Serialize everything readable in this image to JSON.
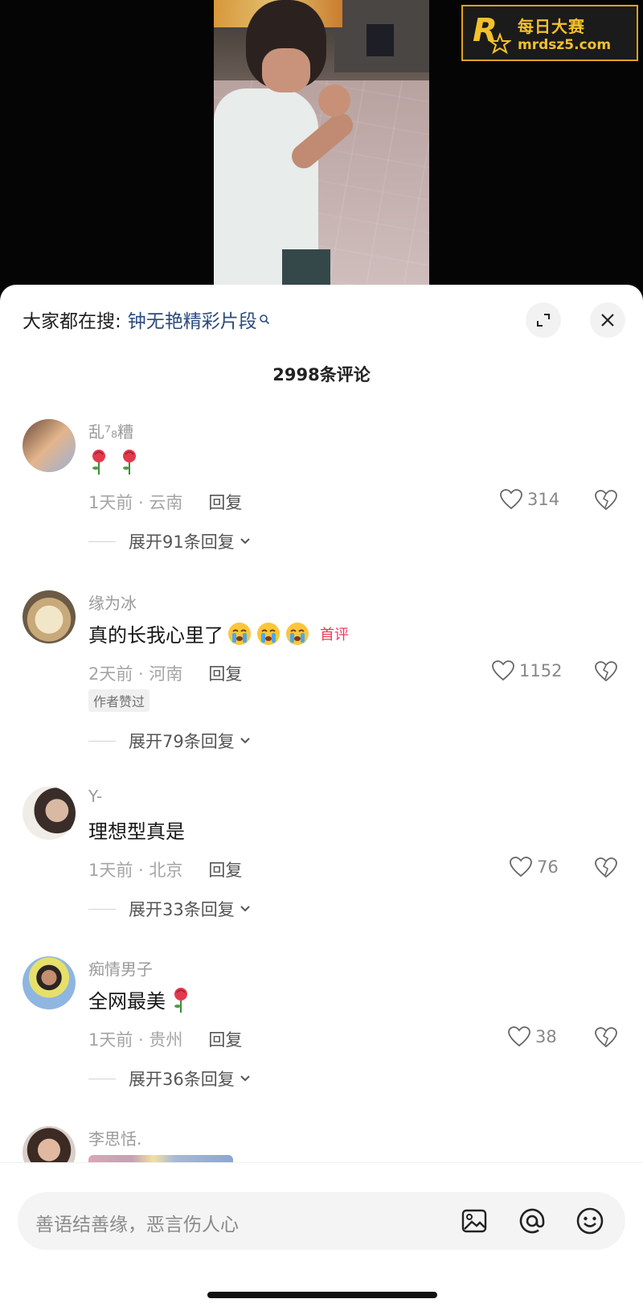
{
  "watermark": {
    "brand_cn": "每日大赛",
    "url": "mrdsz5.com",
    "brand_color": "#f3c12a"
  },
  "panel": {
    "search_prefix": "大家都在搜:",
    "search_term": "钟无艳精彩片段",
    "comment_count": "2998条评论"
  },
  "comments": [
    {
      "username": "乱⁷₈糟",
      "text": "",
      "time_location": "1天前 · 云南",
      "reply_label": "回复",
      "likes": "314",
      "expand_label": "展开91条回复"
    },
    {
      "username": "缘为冰",
      "text": "真的长我心里了",
      "first_tag": "首评",
      "time_location": "2天前 · 河南",
      "reply_label": "回复",
      "likes": "1152",
      "author_liked": "作者赞过",
      "expand_label": "展开79条回复"
    },
    {
      "username": "Y-",
      "text": "理想型真是",
      "time_location": "1天前 · 北京",
      "reply_label": "回复",
      "likes": "76",
      "expand_label": "展开33条回复"
    },
    {
      "username": "痴情男子",
      "text": "全网最美",
      "time_location": "1天前 · 贵州",
      "reply_label": "回复",
      "likes": "38",
      "expand_label": "展开36条回复"
    },
    {
      "username": "李思恬."
    }
  ],
  "input": {
    "placeholder": "善语结善缘，恶言伤人心"
  },
  "colors": {
    "accent_red": "#f0385a",
    "search_blue": "#2a4a7f"
  }
}
